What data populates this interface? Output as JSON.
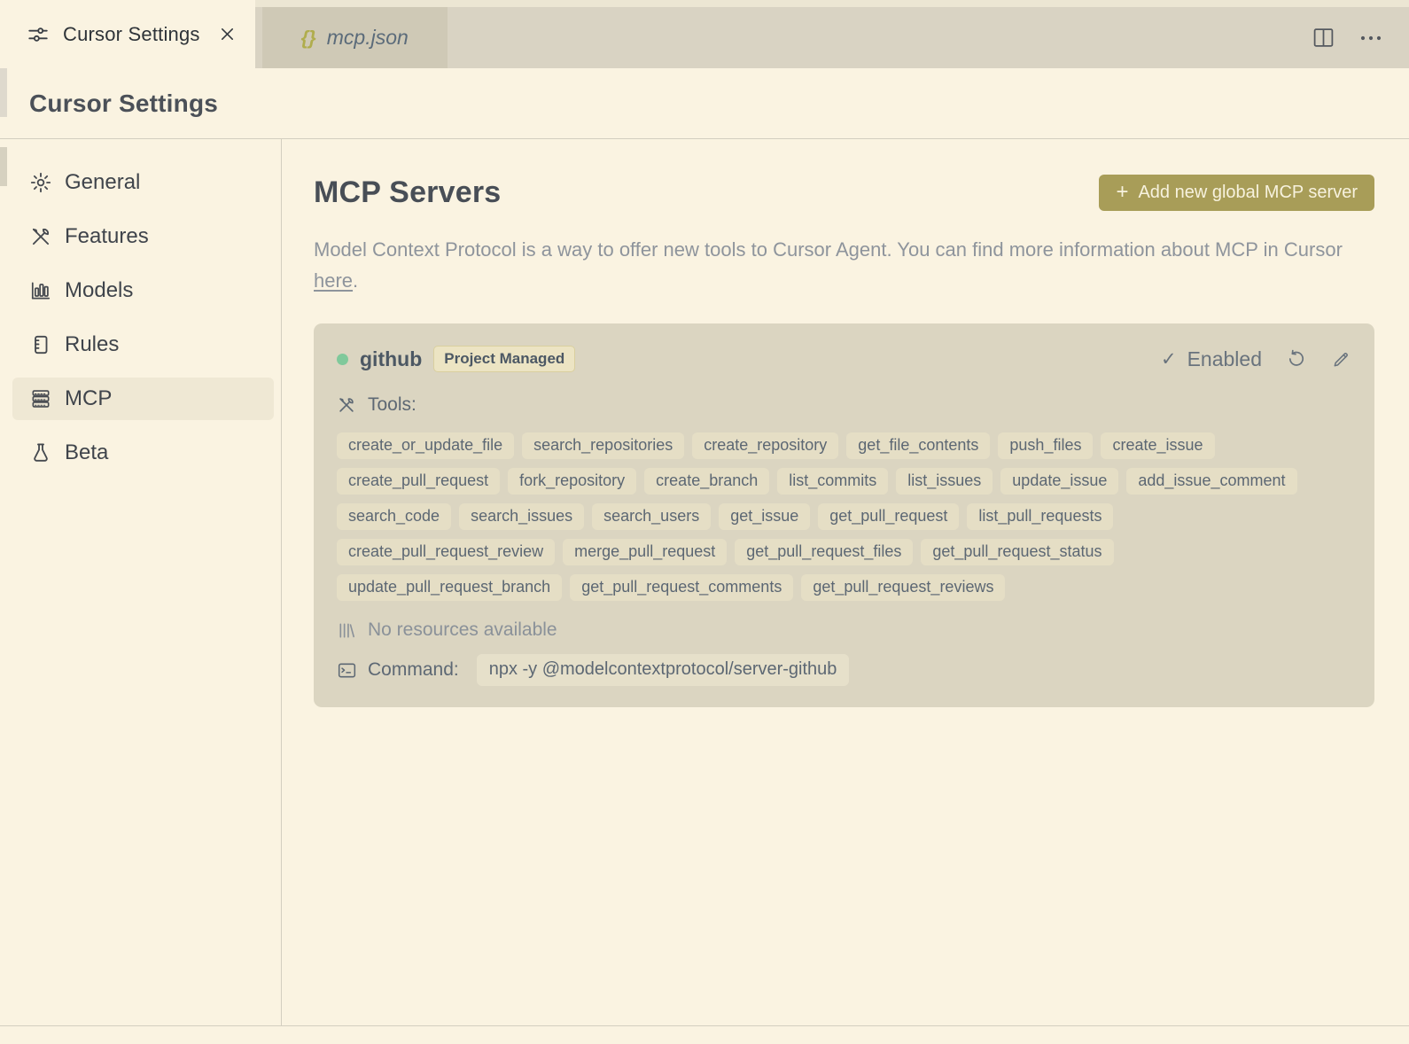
{
  "window": {
    "title": "Cursor Settings"
  },
  "tabbar": {
    "tabs": [
      {
        "label": "Cursor Settings"
      },
      {
        "label": "mcp.json",
        "icon_glyph": "{}"
      }
    ]
  },
  "sidebar": {
    "items": [
      {
        "label": "General"
      },
      {
        "label": "Features"
      },
      {
        "label": "Models"
      },
      {
        "label": "Rules"
      },
      {
        "label": "MCP",
        "active": true
      },
      {
        "label": "Beta"
      }
    ]
  },
  "main": {
    "title": "MCP Servers",
    "add_button": {
      "plus": "+",
      "label": "Add new global MCP server"
    },
    "description": "Model Context Protocol is a way to offer new tools to Cursor Agent. You can find more information about MCP in Cursor ",
    "description_link": "here",
    "description_end": ".",
    "server": {
      "name": "github",
      "badge": "Project Managed",
      "status_check": "✓",
      "status_label": "Enabled",
      "tools_label": "Tools:",
      "tool_rows": [
        [
          "create_or_update_file",
          "search_repositories",
          "create_repository",
          "get_file_contents",
          "push_files",
          "create_issue"
        ],
        [
          "create_pull_request",
          "fork_repository",
          "create_branch",
          "list_commits",
          "list_issues",
          "update_issue",
          "add_issue_comment"
        ],
        [
          "search_code",
          "search_issues",
          "search_users",
          "get_issue",
          "get_pull_request",
          "list_pull_requests"
        ],
        [
          "create_pull_request_review",
          "merge_pull_request",
          "get_pull_request_files",
          "get_pull_request_status"
        ],
        [
          "update_pull_request_branch",
          "get_pull_request_comments",
          "get_pull_request_reviews"
        ]
      ],
      "resources_text": "No resources available",
      "command_label": "Command:",
      "command": "npx -y @modelcontextprotocol/server-github"
    }
  },
  "colors": {
    "background": "#faf3e1",
    "tabbar_bg": "#d9d3c3",
    "inactive_tab_bg": "#cfc9b6",
    "accent_olive": "#a89d58",
    "card_bg": "#dbd5c1",
    "tag_bg": "#e5dec5",
    "badge_bg": "#ece4c3",
    "status_green": "#80c99b",
    "text_dark": "#43484f",
    "text_slate": "#5d6874",
    "text_muted": "#8e949c"
  }
}
